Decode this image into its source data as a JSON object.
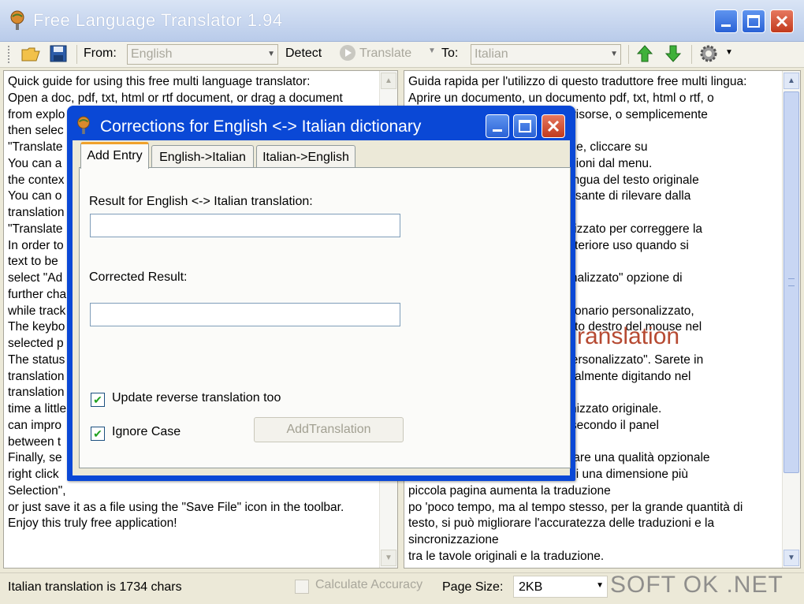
{
  "window": {
    "title": "Free Language Translator 1.94"
  },
  "toolbar": {
    "from_label": "From:",
    "from_value": "English",
    "detect_label": "Detect",
    "translate_label": "Translate",
    "to_label": "To:",
    "to_value": "Italian"
  },
  "left_pane": {
    "text": "Quick guide for using this free multi language translator:\nOpen a doc, pdf, txt, html or rtf document, or drag a document\nfrom explo\nthen selec\n\"Translate\nYou can a\nthe contex\nYou can o\ntranslation\n\"Translate\nIn order to\ntext to be\nselect \"Ad\nfurther cha\nwhile track\nThe keybo\nselected p\nThe status\ntranslation\ntranslation\ntime a little\ncan impro\nbetween t\nFinally, se\nright click\nSelection\",\nor just save it as a file using the \"Save File\" icon in the toolbar.\nEnjoy this truly free application!"
  },
  "right_pane": {
    "text": "Guida rapida per l'utilizzo di questo traduttore free multi lingua:\nAprire un documento, un documento pdf, txt, html o rtf, o\n                                   Esplora risorse, o semplicemente\n                                   annello,\n                                   Da\" lingue, cliccare su\n                                   delle opzioni dal menu.\n                                   ente la lingua del testo originale\n                                   le o il pulsante di rilevare dalla\n\n                                   personalizzato per correggere la\n                                   per un ulteriore uso quando si\n\n                                   io personalizzato\" opzione di\n\n                                   ce al dizionario personalizzato,\n                                   gere, tasto destro del mouse nel\n\n                                   onario personalizzato\". Sarete in\n                                   he manualmente digitando nel\n\n                                   o sincronizzato originale.\n                                   tastiera secondo il panel\n\n                                   visualizzare una qualità opzionale\n                                   lezione di una dimensione più\npiccola pagina aumenta la traduzione\npo 'poco tempo, ma al tempo stesso, per la grande quantità di\ntesto, si può migliorare l'accuratezza delle traduzioni e la\nsincronizzazione\ntra le tavole originali e la traduzione.",
    "overlay": "ranslation"
  },
  "statusbar": {
    "info": "Italian translation is 1734 chars",
    "calc_accuracy": "Calculate Accuracy",
    "page_size_label": "Page Size:",
    "page_size_value": "2KB",
    "watermark": "SOFT OK .NET"
  },
  "dialog": {
    "title": "Corrections for English <-> Italian dictionary",
    "tabs": [
      "Add Entry",
      "English->Italian",
      "Italian->English"
    ],
    "result_label": "Result for English <-> Italian translation:",
    "corrected_label": "Corrected Result:",
    "update_reverse_label": "Update reverse translation too",
    "ignore_case_label": "Ignore Case",
    "add_button": "AddTranslation"
  },
  "colors": {
    "dialog_title": "#0a48d6",
    "close_red": "#c23a1d",
    "window_bg": "#ece9d8"
  }
}
